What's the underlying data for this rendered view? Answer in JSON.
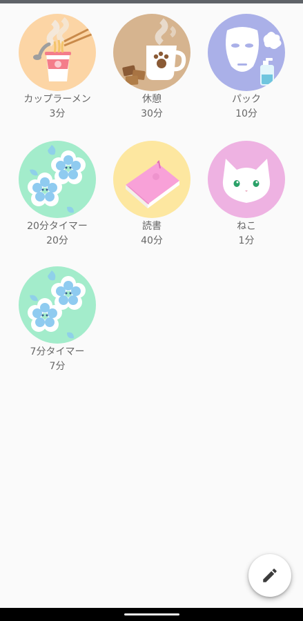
{
  "timers": [
    {
      "name": "カップラーメン",
      "duration": "3分",
      "icon": "cup-noodle-icon",
      "bg": "#fcd5a5"
    },
    {
      "name": "休憩",
      "duration": "30分",
      "icon": "coffee-break-icon",
      "bg": "#d6b48f"
    },
    {
      "name": "パック",
      "duration": "10分",
      "icon": "face-mask-icon",
      "bg": "#aab0e8"
    },
    {
      "name": "20分タイマー",
      "duration": "20分",
      "icon": "flower-icon",
      "bg": "#a3eccb"
    },
    {
      "name": "読書",
      "duration": "40分",
      "icon": "book-icon",
      "bg": "#fde7a0"
    },
    {
      "name": "ねこ",
      "duration": "1分",
      "icon": "cat-icon",
      "bg": "#eeb2e2"
    },
    {
      "name": "7分タイマー",
      "duration": "7分",
      "icon": "flower-icon",
      "bg": "#a3eccb"
    }
  ],
  "fab": {
    "icon": "pencil-icon"
  }
}
